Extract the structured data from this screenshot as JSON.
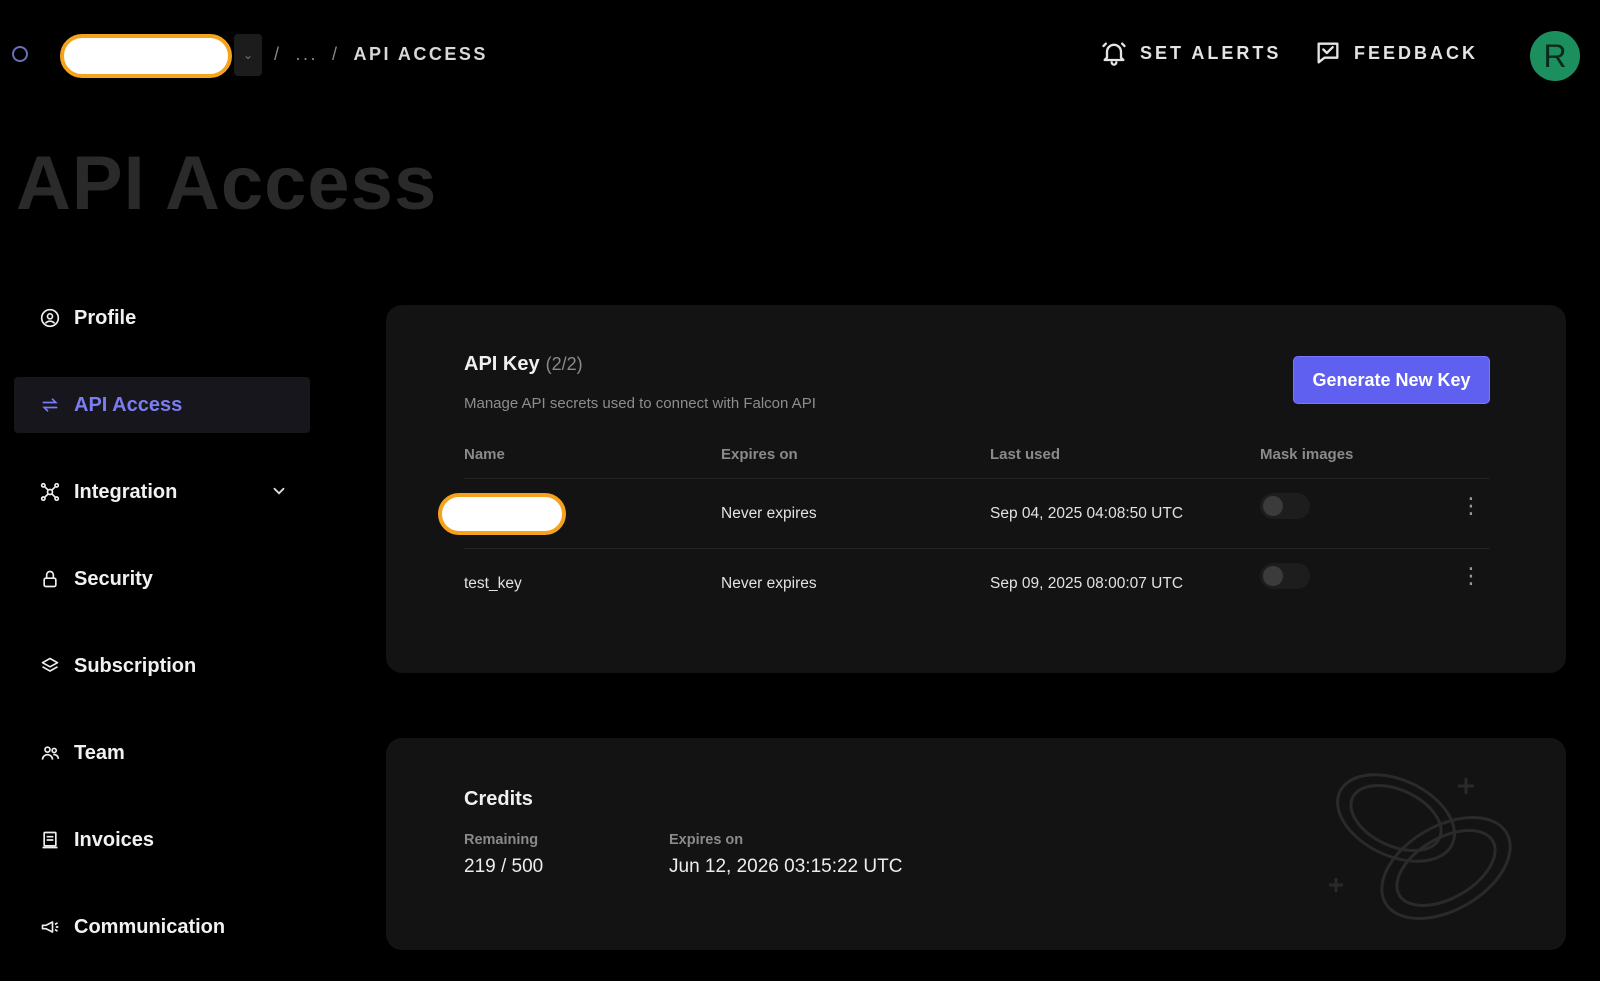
{
  "header": {
    "breadcrumb_sep1": "/",
    "breadcrumb_ellipsis": "...",
    "breadcrumb_sep2": "/",
    "breadcrumb_current": "API ACCESS",
    "set_alerts_label": "SET ALERTS",
    "feedback_label": "FEEDBACK",
    "avatar_initial": "R",
    "avatar_color": "#1b8f5e",
    "accent_color": "#5f5ff0",
    "highlight_color": "#f5a21c"
  },
  "page": {
    "title": "API Access"
  },
  "sidebar": {
    "items": [
      {
        "label": "Profile",
        "icon": "user-circle-icon"
      },
      {
        "label": "API Access",
        "icon": "swap-arrows-icon",
        "active": true
      },
      {
        "label": "Integration",
        "icon": "network-icon",
        "expandable": true
      },
      {
        "label": "Security",
        "icon": "lock-icon"
      },
      {
        "label": "Subscription",
        "icon": "layers-icon"
      },
      {
        "label": "Team",
        "icon": "team-icon"
      },
      {
        "label": "Invoices",
        "icon": "invoice-icon"
      },
      {
        "label": "Communication",
        "icon": "megaphone-icon"
      }
    ]
  },
  "api_keys": {
    "title": "API Key",
    "count": "(2/2)",
    "subtitle": "Manage API secrets used to connect with Falcon API",
    "generate_button": "Generate New Key",
    "columns": [
      "Name",
      "Expires on",
      "Last used",
      "Mask images"
    ],
    "rows": [
      {
        "name": "",
        "expires": "Never expires",
        "last_used": "Sep 04, 2025 04:08:50 UTC",
        "mask_images": false,
        "menu": "⋮"
      },
      {
        "name": "test_key",
        "expires": "Never expires",
        "last_used": "Sep 09, 2025 08:00:07 UTC",
        "mask_images": false,
        "menu": "⋮"
      }
    ]
  },
  "credits": {
    "title": "Credits",
    "remaining_label": "Remaining",
    "remaining_value": "219 / 500",
    "expires_label": "Expires on",
    "expires_value": "Jun 12, 2026 03:15:22 UTC"
  }
}
